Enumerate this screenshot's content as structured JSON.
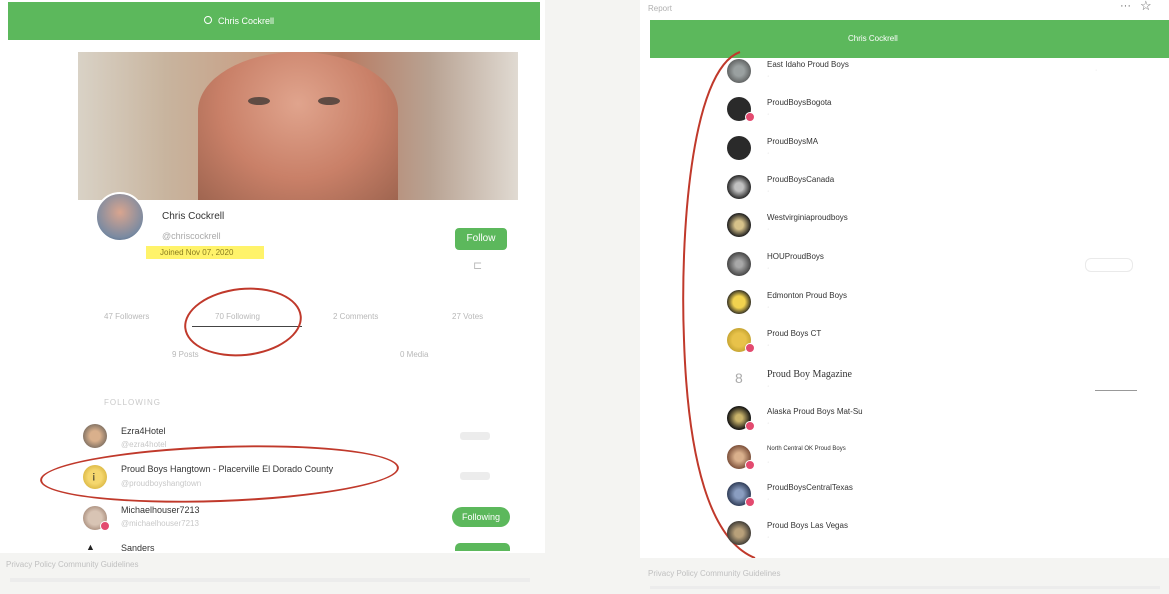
{
  "left": {
    "search_value": "Chris Cockrell",
    "profile": {
      "name": "Chris Cockrell",
      "handle": "@chriscockrell",
      "joined": "Joined Nov 07, 2020",
      "follow_label": "Follow"
    },
    "stats": {
      "followers": "47 Followers",
      "following": "70 Following",
      "comments": "2 Comments",
      "votes": "27 Votes",
      "posts": "9 Posts",
      "media": "0 Media"
    },
    "section_title": "FOLLOWING",
    "list": [
      {
        "name": "Ezra4Hotel",
        "sub": "@ezra4hotel",
        "action": ""
      },
      {
        "name": "Proud Boys Hangtown - Placerville El Dorado County",
        "sub": "@proudboyshangtown",
        "action": ""
      },
      {
        "name": "Michaelhouser7213",
        "sub": "@michaelhouser7213",
        "action": "Following"
      },
      {
        "name": "Sanders",
        "sub": "",
        "action": ""
      }
    ],
    "footer": "Privacy Policy   Community Guidelines"
  },
  "right": {
    "top_label": "Report",
    "search_value": "Chris Cockrell",
    "list": [
      {
        "name": "East Idaho Proud Boys"
      },
      {
        "name": "ProudBoysBogota"
      },
      {
        "name": "ProudBoysMA"
      },
      {
        "name": "ProudBoysCanada"
      },
      {
        "name": "Westvirginiaproudboys"
      },
      {
        "name": "HOUProudBoys"
      },
      {
        "name": "Edmonton Proud Boys"
      },
      {
        "name": "Proud Boys CT"
      },
      {
        "name": "Proud Boy Magazine"
      },
      {
        "name": "Alaska Proud Boys Mat-Su"
      },
      {
        "name": "North Central OK Proud Boys"
      },
      {
        "name": "ProudBoysCentralTexas"
      },
      {
        "name": "Proud Boys Las Vegas"
      }
    ],
    "footer": "Privacy Policy   Community Guidelines"
  },
  "colors": {
    "brand": "#5cb85c",
    "annotation": "#c0392b",
    "highlight": "#fff36a"
  }
}
